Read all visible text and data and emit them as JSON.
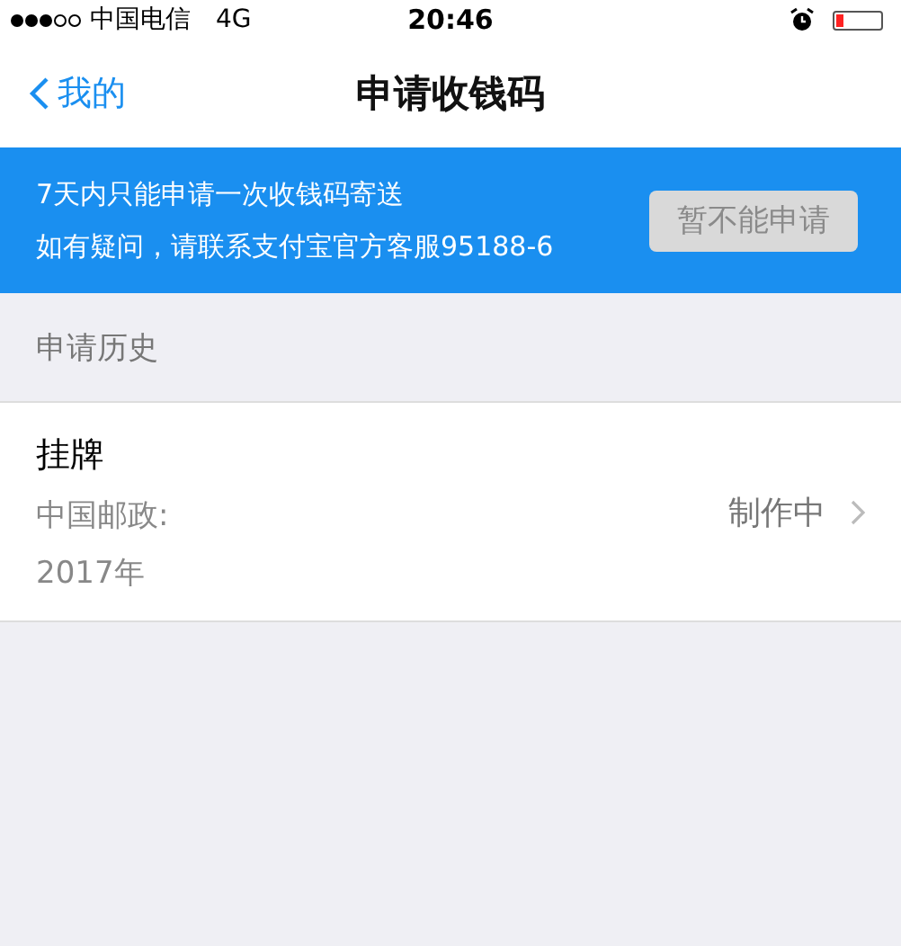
{
  "status_bar": {
    "carrier": "中国电信",
    "network": "4G",
    "time": "20:46",
    "battery": {
      "level": 0.15
    }
  },
  "nav": {
    "back": "我的",
    "title": "申请收钱码"
  },
  "notice": {
    "lines": [
      "7天内只能申请一次收钱码寄送",
      "如有疑问，请联系支付宝官方客服95188-6"
    ],
    "button": {
      "label": "暂不能申请",
      "disabled": true
    }
  },
  "section_header": "申请历史",
  "history": [
    {
      "title": "挂牌",
      "detail": "中国邮政:",
      "date": "2017年",
      "status": "制作中"
    }
  ]
}
